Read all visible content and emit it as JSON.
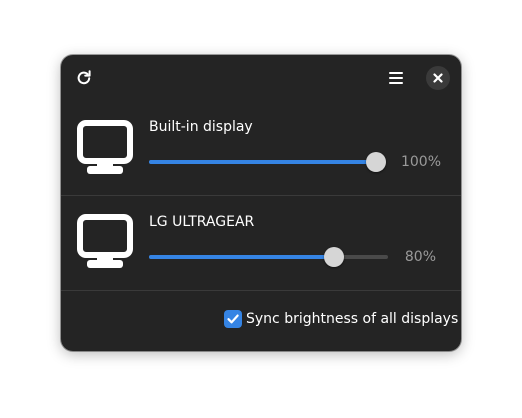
{
  "header": {
    "refresh_icon": "refresh-icon",
    "menu_icon": "hamburger-menu-icon",
    "close_icon": "close-icon"
  },
  "displays": [
    {
      "name": "Built-in display",
      "brightness": 100,
      "brightness_label": "100%",
      "icon": "monitor-icon"
    },
    {
      "name": "LG ULTRAGEAR",
      "brightness": 80,
      "brightness_label": "80%",
      "icon": "monitor-icon"
    }
  ],
  "footer": {
    "sync_label": "Sync brightness of all displays",
    "sync_checked": true
  },
  "colors": {
    "accent": "#3584e4",
    "window_bg": "#242424",
    "knob": "#d6d6d6",
    "muted_text": "#9a9a9a"
  }
}
